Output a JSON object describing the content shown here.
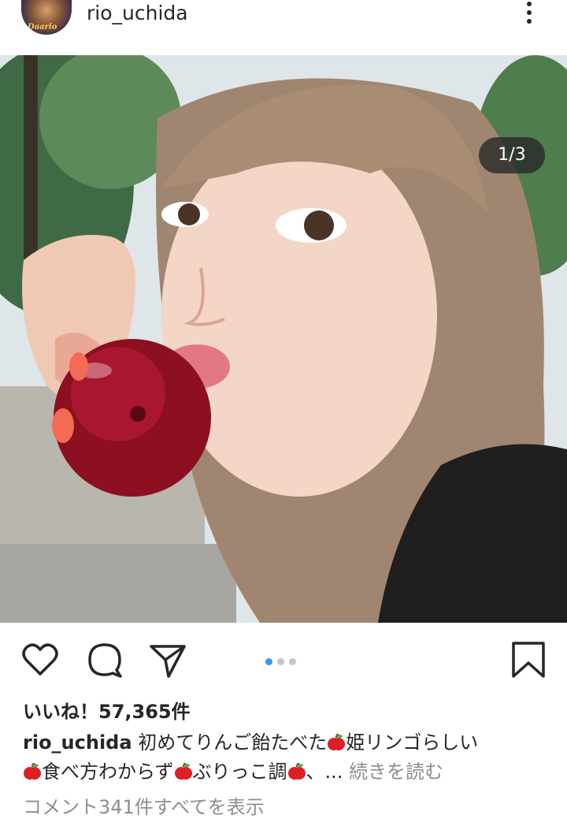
{
  "post": {
    "username": "rio_uchida",
    "avatar_label": "Daario",
    "image_counter": "1/3",
    "likes_text": "いいね！57,365件",
    "caption": {
      "username": "rio_uchida",
      "part1": "初めてりんご飴たべた",
      "part2": "姫リンゴらしい",
      "part3": "食べ方わからず",
      "part4": "ぶりっこ調",
      "part5": "、...",
      "more_label": "続きを読む"
    },
    "view_comments": "コメント341件すべてを表示"
  },
  "colors": {
    "text": "#262626",
    "muted": "#8e8e8e",
    "active_dot": "#3897f0",
    "inactive_dot": "#c7c7c7"
  },
  "icons": [
    "more-vertical-icon",
    "heart-icon",
    "comment-icon",
    "share-icon",
    "bookmark-icon",
    "apple-emoji-icon"
  ]
}
